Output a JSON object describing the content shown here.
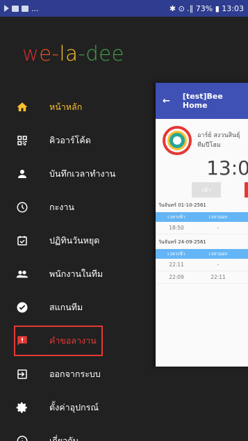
{
  "statusbar": {
    "left": "...",
    "right": "✱ ⊙ .∥ 73% ▮ 13:03"
  },
  "logo": {
    "parts": [
      "w",
      "e-",
      "la",
      "-d",
      "ee"
    ]
  },
  "menu": {
    "items": [
      {
        "label": "หน้าหลัก",
        "icon": "home-icon"
      },
      {
        "label": "คิวอาร์โค้ด",
        "icon": "qr-code-icon"
      },
      {
        "label": "บันทึกเวลาทำงาน",
        "icon": "person-icon"
      },
      {
        "label": "กะงาน",
        "icon": "clock-icon"
      },
      {
        "label": "ปฏิทินวันหยุด",
        "icon": "calendar-check-icon"
      },
      {
        "label": "พนักงานในทีม",
        "icon": "group-icon"
      },
      {
        "label": "สแกนทีม",
        "icon": "check-circle-icon"
      },
      {
        "label": "คำขอลางาน",
        "icon": "alert-message-icon"
      },
      {
        "label": "ออกจากระบบ",
        "icon": "logout-icon"
      },
      {
        "label": "ตั้งค่าอุปกรณ์",
        "icon": "gear-icon"
      },
      {
        "label": "เกี่ยวกับ",
        "icon": "info-icon"
      }
    ]
  },
  "preview": {
    "back": "←",
    "title": "[test]Bee Home",
    "user_name": "อาร์ย์ สงวนสินธุ์",
    "team": "ทีมปีโฮม",
    "time": "13:0",
    "btn_in": "เข้า",
    "day1": {
      "date": "วันจันทร์ 01-10-2561",
      "col_in": "เวลาเข้า",
      "col_out": "เวลาออก",
      "rows": [
        {
          "in": "18:50",
          "out": "-"
        }
      ]
    },
    "day2": {
      "date": "วันจันทร์ 24-09-2561",
      "col_in": "เวลาเข้า",
      "col_out": "เวลาออก",
      "rows": [
        {
          "in": "22:11",
          "out": "-"
        },
        {
          "in": "22:09",
          "out": "22:11"
        }
      ]
    }
  },
  "colors": {
    "drawer_bg": "#212121",
    "statusbar": "#2e3d8f",
    "accent_yellow": "#fbc02d",
    "highlight_red": "#e53935",
    "appbar": "#3f51b5"
  }
}
